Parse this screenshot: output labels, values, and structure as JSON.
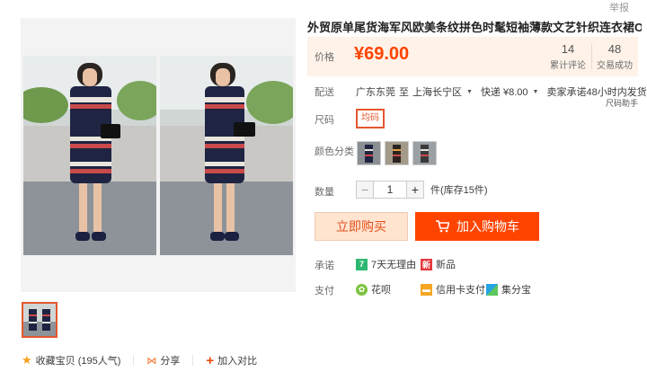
{
  "top": {
    "report": "举报"
  },
  "product": {
    "title": "外贸原单尾货海军风欧美条纹拼色时髦短袖薄款文艺针织连衣裙OP"
  },
  "price": {
    "label": "价格",
    "value": "¥69.00",
    "reviews_count": "14",
    "reviews_label": "累计评论",
    "sales_count": "48",
    "sales_label": "交易成功"
  },
  "shipping": {
    "label": "配送",
    "from": "广东东莞",
    "to_prefix": "至",
    "to": "上海长宁区",
    "method": "快递 ¥8.00",
    "promise": "卖家承诺48小时内发货",
    "note": "尺码助手"
  },
  "size": {
    "label": "尺码",
    "options": [
      "均码"
    ]
  },
  "colors": {
    "label": "颜色分类"
  },
  "quantity": {
    "label": "数量",
    "value": "1",
    "stock": "件(库存15件)",
    "minus": "−",
    "plus": "+"
  },
  "actions": {
    "buy": "立即购买",
    "cart": "加入购物车"
  },
  "promise": {
    "label": "承诺",
    "return_badge": "7",
    "return": "7天无理由",
    "new_badge": "新",
    "new": "新品"
  },
  "payment": {
    "label": "支付",
    "huabei": "花呗",
    "credit": "信用卡支付",
    "jfb": "集分宝"
  },
  "footer": {
    "favorite": "收藏宝贝 (195人气)",
    "share": "分享",
    "compare": "加入对比"
  },
  "colors_theme": {
    "accent": "#ff4400",
    "price": "#ff4400",
    "buy_bg": "#ffe4d0",
    "price_bg": "#fff2e8"
  }
}
